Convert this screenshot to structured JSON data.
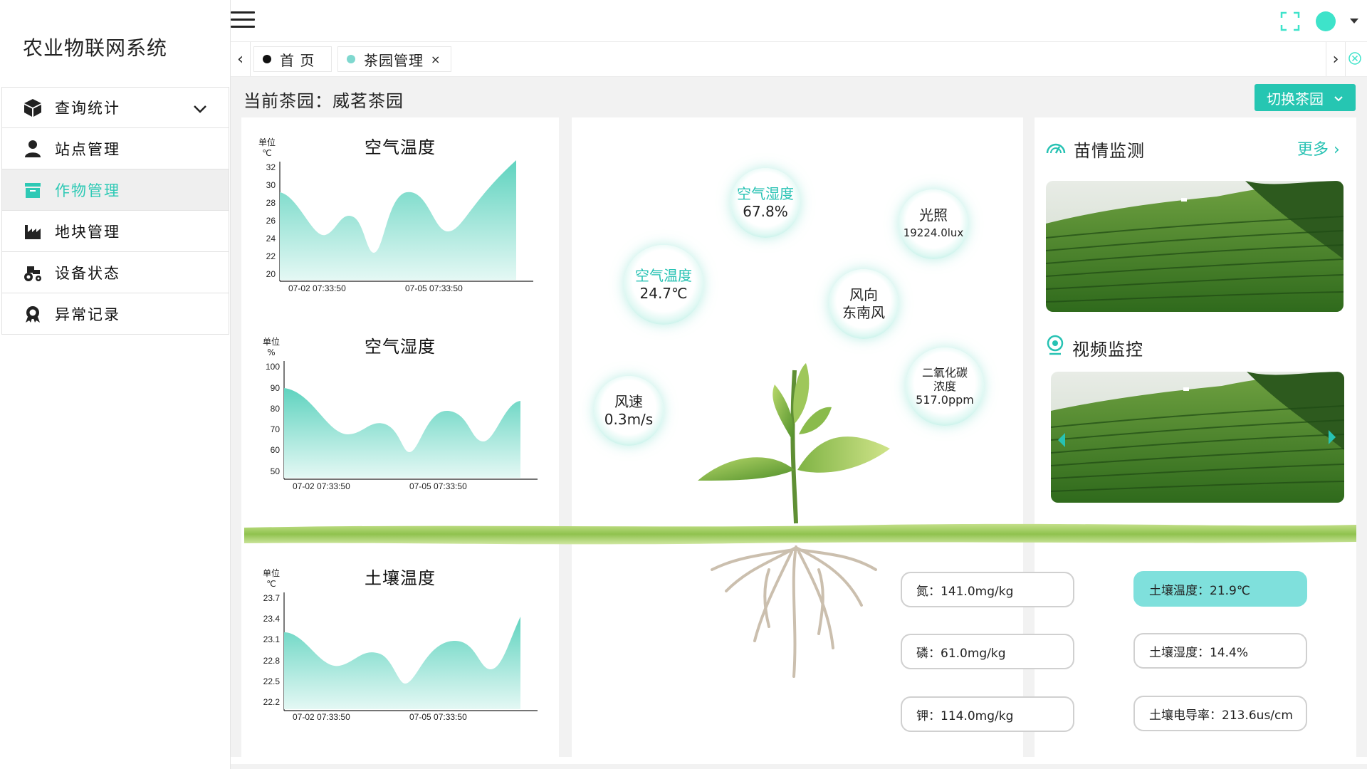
{
  "app": {
    "title": "农业物联网系统"
  },
  "sidebar": {
    "items": [
      {
        "label": "查询统计",
        "icon": "cube-icon",
        "has_submenu": true
      },
      {
        "label": "站点管理",
        "icon": "user-icon"
      },
      {
        "label": "作物管理",
        "icon": "folder-icon",
        "active": true
      },
      {
        "label": "地块管理",
        "icon": "factory-icon"
      },
      {
        "label": "设备状态",
        "icon": "tractor-icon"
      },
      {
        "label": "异常记录",
        "icon": "badge-icon"
      }
    ]
  },
  "tabs": {
    "items": [
      {
        "label": "首 页",
        "dot_color": "#111111"
      },
      {
        "label": "茶园管理",
        "dot_color": "#7fd8cf",
        "close": "×"
      }
    ]
  },
  "header": {
    "current_garden_prefix": "当前茶园：",
    "current_garden": "威茗茶园",
    "switch_button": "切换茶园"
  },
  "charts": [
    {
      "title": "空气温度",
      "unit_label": "单位",
      "unit": "℃",
      "y_ticks": [
        "32",
        "30",
        "28",
        "26",
        "24",
        "22",
        "20"
      ],
      "x_ticks": [
        "07-02 07:33:50",
        "07-05 07:33:50"
      ]
    },
    {
      "title": "空气湿度",
      "unit_label": "单位",
      "unit": "%",
      "y_ticks": [
        "100",
        "90",
        "80",
        "70",
        "60",
        "50"
      ],
      "x_ticks": [
        "07-02 07:33:50",
        "07-05 07:33:50"
      ]
    },
    {
      "title": "土壤温度",
      "unit_label": "单位",
      "unit": "℃",
      "y_ticks": [
        "23.7",
        "23.4",
        "23.1",
        "22.8",
        "22.5",
        "22.2"
      ],
      "x_ticks": [
        "07-02 07:33:50",
        "07-05 07:33:50"
      ]
    }
  ],
  "bubbles": {
    "air_humidity": {
      "label": "空气湿度",
      "value": "67.8%"
    },
    "light": {
      "label": "光照",
      "value": "19224.0lux"
    },
    "air_temp": {
      "label": "空气温度",
      "value": "24.7℃"
    },
    "wind_dir": {
      "label": "风向",
      "value": "东南风"
    },
    "co2": {
      "label": "二氧化碳",
      "label2": "浓度",
      "value": "517.0ppm"
    },
    "wind_speed": {
      "label": "风速",
      "value": "0.3m/s"
    }
  },
  "soil": {
    "nitrogen": "氮：141.0mg/kg",
    "phosphorus": "磷：61.0mg/kg",
    "potassium": "钾：114.0mg/kg",
    "soil_temp": "土壤温度：21.9℃",
    "soil_humidity": "土壤湿度：14.4%",
    "soil_ec": "土壤电导率：213.6us/cm"
  },
  "right": {
    "growth_title": "苗情监测",
    "more": "更多",
    "video_title": "视频监控"
  },
  "colors": {
    "accent": "#26c6b2",
    "chart_fill_top": "#5fd3bf",
    "highlight_soil": "#7fe0dc"
  }
}
